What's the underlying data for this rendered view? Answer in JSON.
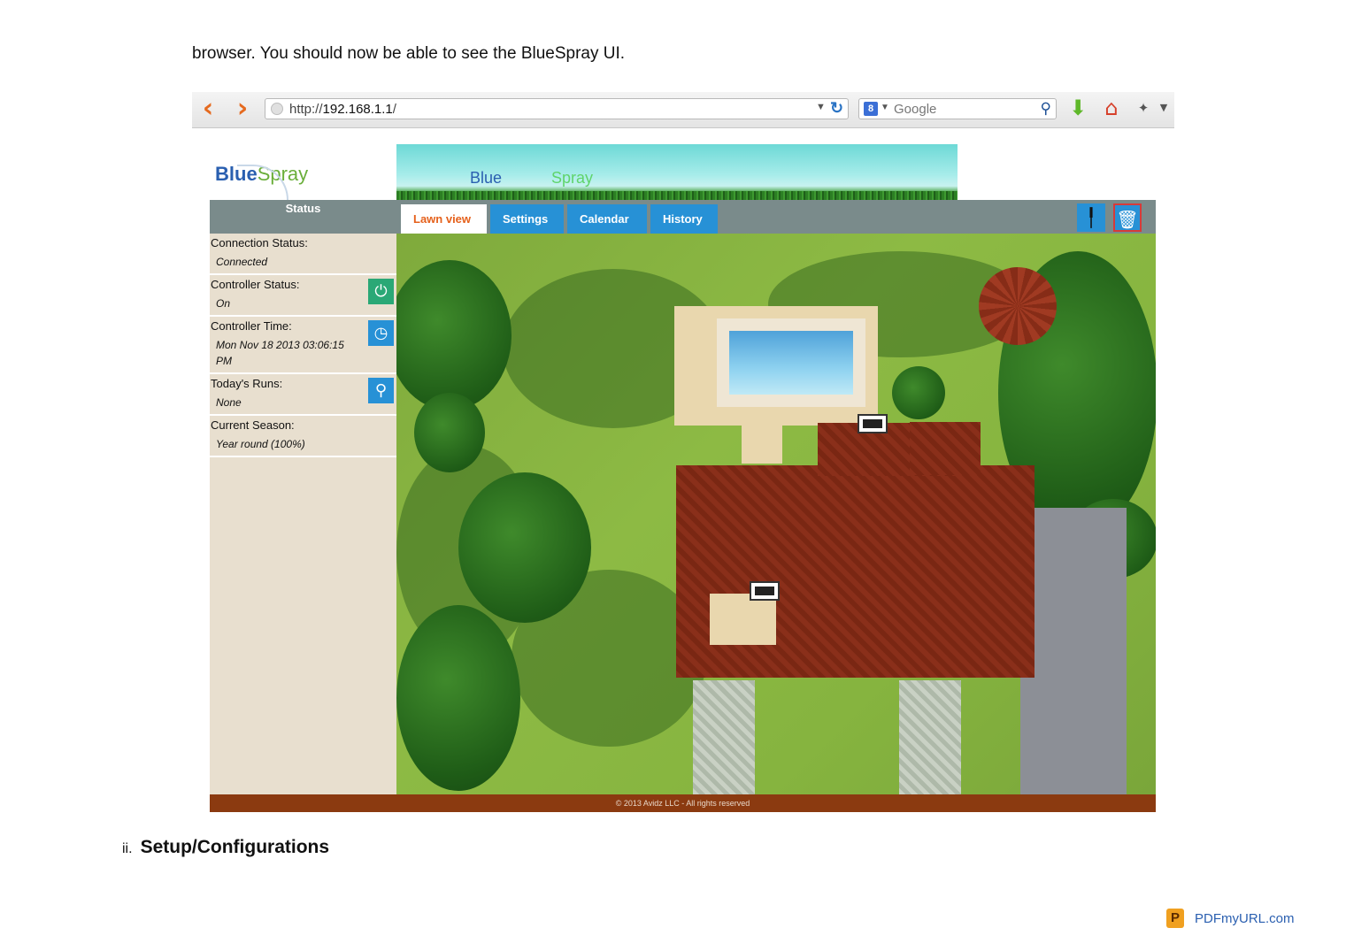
{
  "doc": {
    "intro_text": "browser. You should now be able to see the BlueSpray UI.",
    "section_number": "ii.",
    "section_title": "Setup/Configurations",
    "footer_brand": "PDFmyURL.com"
  },
  "browser": {
    "url_prefix": "http://",
    "url_host": "192.168.1.1",
    "url_suffix": "/",
    "search_placeholder": "Google",
    "icons": {
      "back": "chevron-left",
      "forward": "chevron-right",
      "refresh": "refresh",
      "search": "magnifier",
      "download": "down-arrow",
      "home": "house",
      "addons": "puzzle"
    },
    "accent_color": "#e56a1f"
  },
  "app": {
    "logo_blue": "Blue",
    "logo_green": "Spray",
    "banner_blue": "Blue",
    "banner_green": "Spray",
    "sidebar": {
      "header": "Status",
      "items": [
        {
          "label": "Connection Status:",
          "value": "Connected",
          "icon": null
        },
        {
          "label": "Controller Status:",
          "value": "On",
          "icon": "power-icon"
        },
        {
          "label": "Controller Time:",
          "value": "Mon Nov 18 2013 03:06:15 PM",
          "icon": "clock-icon"
        },
        {
          "label": "Today's Runs:",
          "value": "None",
          "icon": "faucet-icon"
        },
        {
          "label": "Current Season:",
          "value": "Year round (100%)",
          "icon": null
        }
      ]
    },
    "tabs": [
      {
        "label": "Lawn view",
        "active": true
      },
      {
        "label": "Settings",
        "active": false
      },
      {
        "label": "Calendar",
        "active": false
      },
      {
        "label": "History",
        "active": false
      }
    ],
    "tools": [
      "sprinkler-icon",
      "trash-icon"
    ],
    "footer": "© 2013 Avidz LLC - All rights reserved",
    "colors": {
      "tab_blue": "#2791d6",
      "active_tab_text": "#e5611c",
      "sidebar_bg": "#e8dfcf",
      "header_gray": "#7a8b8b",
      "footer_brown": "#8b3a10"
    }
  }
}
